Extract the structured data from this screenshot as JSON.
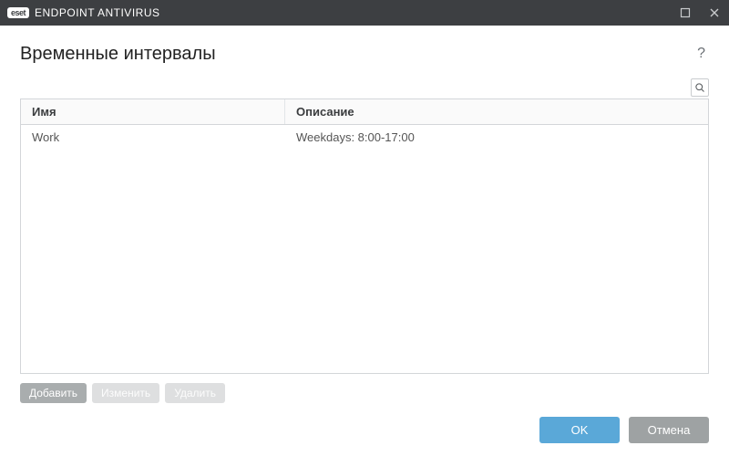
{
  "titlebar": {
    "logo_text": "eset",
    "app_name": "ENDPOINT ANTIVIRUS"
  },
  "page": {
    "title": "Временные интервалы"
  },
  "table": {
    "columns": {
      "name": "Имя",
      "desc": "Описание"
    },
    "rows": [
      {
        "name": "Work",
        "desc": "Weekdays: 8:00-17:00"
      }
    ]
  },
  "actions": {
    "add": "Добавить",
    "edit": "Изменить",
    "delete": "Удалить"
  },
  "footer": {
    "ok": "OK",
    "cancel": "Отмена"
  }
}
